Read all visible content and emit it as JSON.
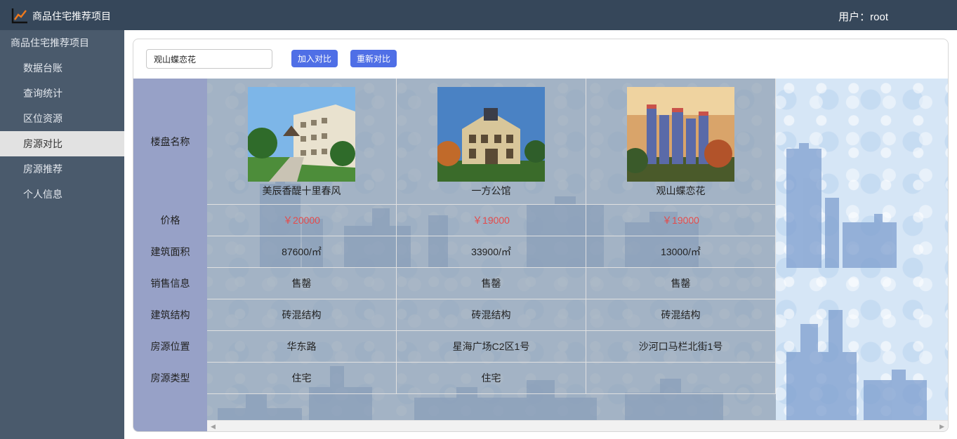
{
  "header": {
    "app_title": "商品住宅推荐项目",
    "user_label": "用户：root",
    "logo_icon": "line-chart-icon"
  },
  "sidebar": {
    "title": "商品住宅推荐项目",
    "items": [
      {
        "label": "数据台账",
        "active": false
      },
      {
        "label": "查询统计",
        "active": false
      },
      {
        "label": "区位资源",
        "active": false
      },
      {
        "label": "房源对比",
        "active": true
      },
      {
        "label": "房源推荐",
        "active": false
      },
      {
        "label": "个人信息",
        "active": false
      }
    ]
  },
  "toolbar": {
    "search_value": "观山蝶恋花",
    "add_label": "加入对比",
    "reset_label": "重新对比"
  },
  "compare": {
    "row_labels": [
      "楼盘名称",
      "价格",
      "建筑面积",
      "销售信息",
      "建筑结构",
      "房源位置",
      "房源类型"
    ],
    "properties": [
      {
        "name": "美辰香醍十里春风",
        "price": "￥20000",
        "area": "87600/㎡",
        "sales": "售罄",
        "structure": "砖混结构",
        "location": "华东路",
        "type": "住宅"
      },
      {
        "name": "一方公馆",
        "price": "￥19000",
        "area": "33900/㎡",
        "sales": "售罄",
        "structure": "砖混结构",
        "location": "星海广场C2区1号",
        "type": "住宅"
      },
      {
        "name": "观山蝶恋花",
        "price": "￥19000",
        "area": "13000/㎡",
        "sales": "售罄",
        "structure": "砖混结构",
        "location": "沙河口马栏北街1号",
        "type": ""
      }
    ]
  },
  "colors": {
    "header_bg": "#36475a",
    "sidebar_bg": "#4a5a6c",
    "button_blue": "#4f6fe6",
    "price_red": "#e44b4b",
    "label_col_bg": "#97a1c7"
  }
}
